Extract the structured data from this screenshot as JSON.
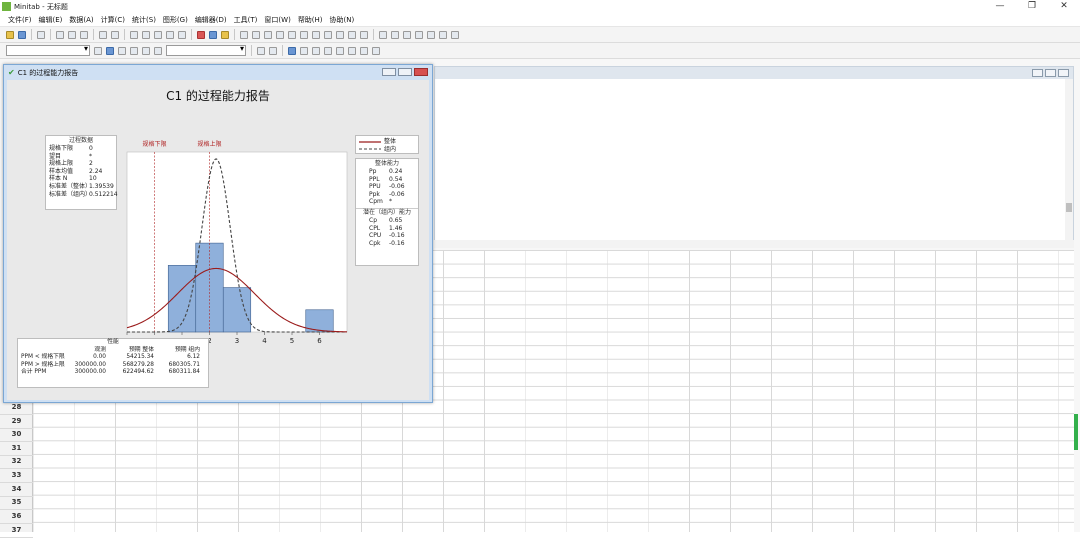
{
  "app": {
    "title": "Minitab - 无标题",
    "window_controls": [
      "—",
      "❐",
      "✕"
    ]
  },
  "menu": [
    "文件(F)",
    "编辑(E)",
    "数据(A)",
    "计算(C)",
    "统计(S)",
    "图形(G)",
    "编辑器(D)",
    "工具(T)",
    "窗口(W)",
    "帮助(H)",
    "协助(N)"
  ],
  "icons": {
    "app": "minitab-logo-icon",
    "check": "check-icon",
    "minimize": "minimize-icon",
    "maximize": "maximize-icon",
    "close": "close-icon"
  },
  "worksheet": {
    "row_labels": [
      "28",
      "29",
      "30",
      "31",
      "32",
      "33",
      "34",
      "35",
      "36",
      "37"
    ]
  },
  "graph": {
    "window_title": "C1 的过程能力报告",
    "report_title": "C1 的过程能力报告",
    "process_data": {
      "title": "过程数据",
      "rows": [
        {
          "k": "规格下限",
          "v": "0"
        },
        {
          "k": "望目",
          "v": "*"
        },
        {
          "k": "规格上限",
          "v": "2"
        },
        {
          "k": "样本均值",
          "v": "2.24"
        },
        {
          "k": "样本 N",
          "v": "10"
        },
        {
          "k": "标准差（整体）",
          "v": "1.39539"
        },
        {
          "k": "标准差（组内）",
          "v": "0.512214"
        }
      ]
    },
    "legend": {
      "overall": "整体",
      "within": "组内"
    },
    "overall_capability": {
      "title": "整体能力",
      "rows": [
        {
          "k": "Pp",
          "v": "0.24"
        },
        {
          "k": "PPL",
          "v": "0.54"
        },
        {
          "k": "PPU",
          "v": "-0.06"
        },
        {
          "k": "Ppk",
          "v": "-0.06"
        },
        {
          "k": "Cpm",
          "v": "*"
        }
      ]
    },
    "potential_capability": {
      "title": "潜在（组内）能力",
      "rows": [
        {
          "k": "Cp",
          "v": "0.65"
        },
        {
          "k": "CPL",
          "v": "1.46"
        },
        {
          "k": "CPU",
          "v": "-0.16"
        },
        {
          "k": "Cpk",
          "v": "-0.16"
        }
      ]
    },
    "performance": {
      "title": "性能",
      "headers": [
        "",
        "观测",
        "预期 整体",
        "预期 组内"
      ],
      "rows": [
        [
          "PPM < 规格下限",
          "0.00",
          "54215.34",
          "6.12"
        ],
        [
          "PPM > 规格上限",
          "300000.00",
          "568279.28",
          "680305.71"
        ],
        [
          "合计 PPM",
          "300000.00",
          "622494.62",
          "680311.84"
        ]
      ]
    }
  },
  "chart_data": {
    "type": "bar",
    "title": "C1 的过程能力报告",
    "bins": [
      {
        "x0": 0.5,
        "x1": 1.5,
        "count": 3
      },
      {
        "x0": 1.5,
        "x1": 2.5,
        "count": 4
      },
      {
        "x0": 2.5,
        "x1": 3.5,
        "count": 2
      },
      {
        "x0": 3.5,
        "x1": 4.5,
        "count": 0
      },
      {
        "x0": 4.5,
        "x1": 5.5,
        "count": 0
      },
      {
        "x0": 5.5,
        "x1": 6.5,
        "count": 1
      }
    ],
    "xlim": [
      -1,
      7
    ],
    "x_ticks": [
      -1,
      0,
      1,
      2,
      3,
      4,
      5,
      6
    ],
    "lsl": 0,
    "usl": 2,
    "lsl_label": "规格下限",
    "usl_label": "规格上限",
    "mean": 2.24,
    "sd_overall": 1.39539,
    "sd_within": 0.512214,
    "n": 10,
    "bin_width": 1,
    "colors": {
      "bars": "#8fb0db",
      "bar_edge": "#3d5f8e",
      "overall": "#9b1c1c",
      "within": "#444444",
      "spec": "#b02525"
    }
  }
}
